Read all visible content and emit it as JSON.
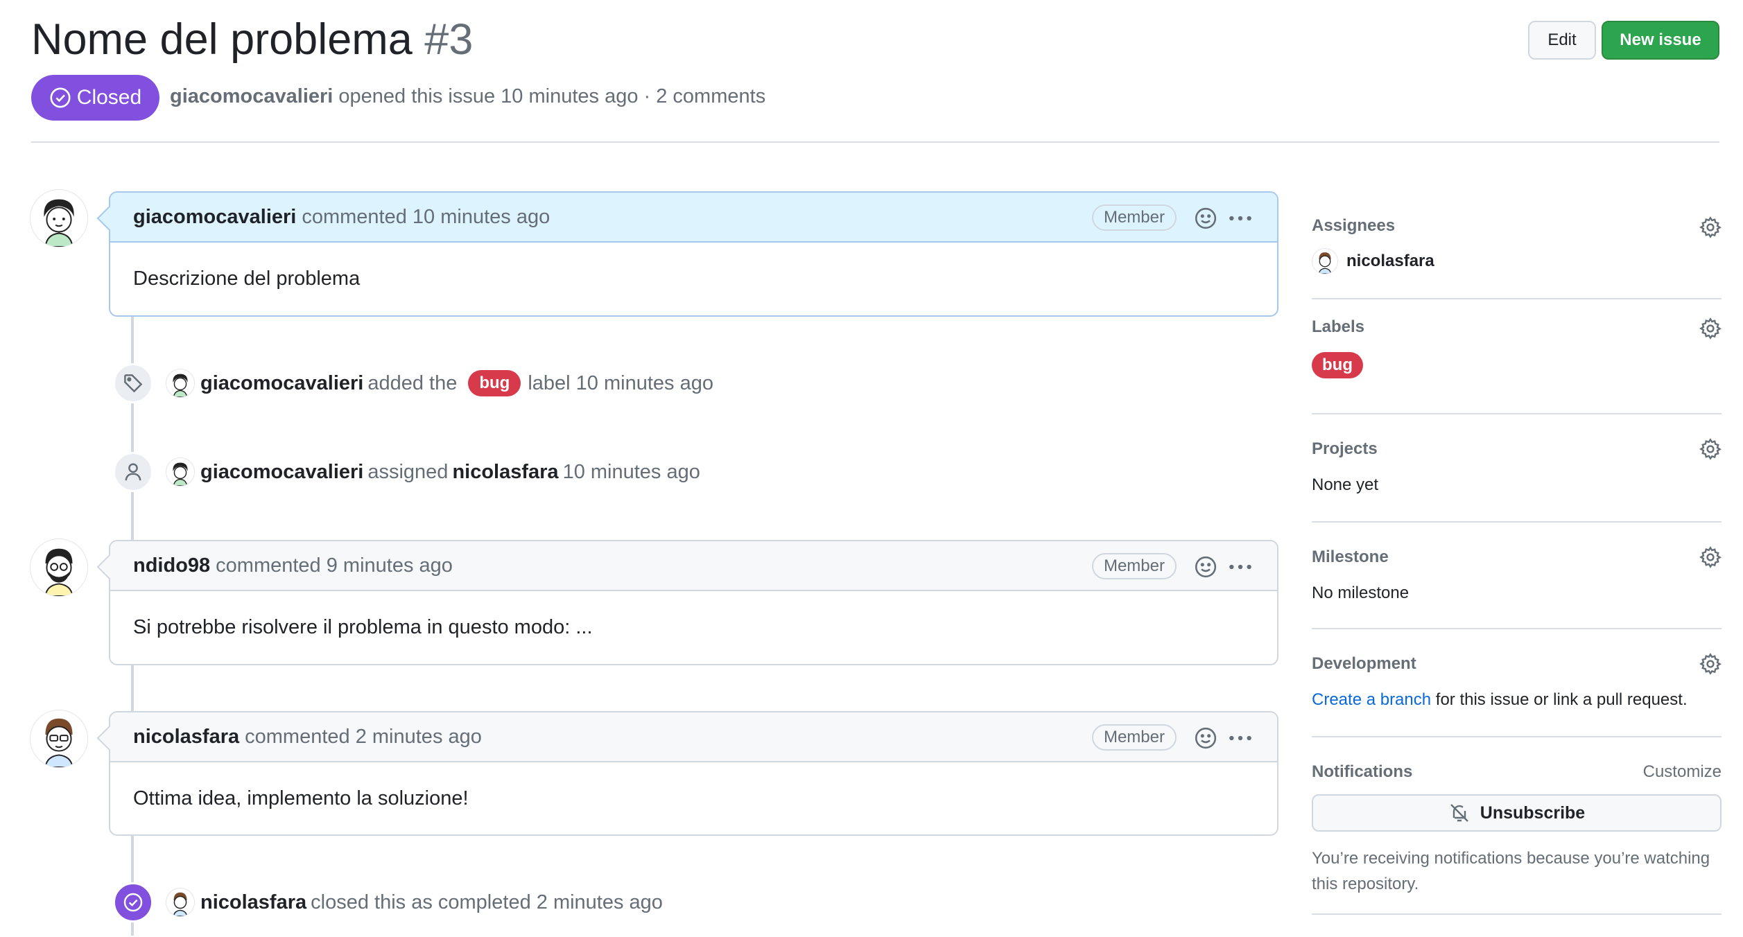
{
  "issue": {
    "title": "Nome del problema",
    "number": "#3",
    "state": "Closed",
    "author": "giacomocavalieri",
    "opened_text": "opened this issue 10 minutes ago · 2 comments"
  },
  "actions": {
    "edit_label": "Edit",
    "new_issue_label": "New issue"
  },
  "timeline": {
    "comment1": {
      "author": "giacomocavalieri",
      "meta": "commented 10 minutes ago",
      "badge": "Member",
      "body": "Descrizione del problema"
    },
    "event_label": {
      "actor": "giacomocavalieri",
      "text_before": "added the",
      "label": "bug",
      "text_after": "label 10 minutes ago"
    },
    "event_assign": {
      "actor": "giacomocavalieri",
      "text": "assigned",
      "assignee": "nicolasfara",
      "time": "10 minutes ago"
    },
    "comment2": {
      "author": "ndido98",
      "meta": "commented 9 minutes ago",
      "badge": "Member",
      "body": "Si potrebbe risolvere il problema in questo modo: ..."
    },
    "comment3": {
      "author": "nicolasfara",
      "meta": "commented 2 minutes ago",
      "badge": "Member",
      "body": "Ottima idea, implemento la soluzione!"
    },
    "event_close": {
      "actor": "nicolasfara",
      "text": "closed this as completed 2 minutes ago"
    }
  },
  "sidebar": {
    "assignees": {
      "heading": "Assignees",
      "user": "nicolasfara"
    },
    "labels": {
      "heading": "Labels",
      "label": "bug"
    },
    "projects": {
      "heading": "Projects",
      "value": "None yet"
    },
    "milestone": {
      "heading": "Milestone",
      "value": "No milestone"
    },
    "development": {
      "heading": "Development",
      "link": "Create a branch",
      "text": "for this issue or link a pull request."
    },
    "notifications": {
      "heading": "Notifications",
      "customize": "Customize",
      "button": "Unsubscribe",
      "note": "You’re receiving notifications because you’re watching this repository."
    }
  },
  "colors": {
    "closed": "#8250df",
    "new_issue": "#2da44e",
    "bug_label": "#d73a4a",
    "link": "#0969da"
  }
}
